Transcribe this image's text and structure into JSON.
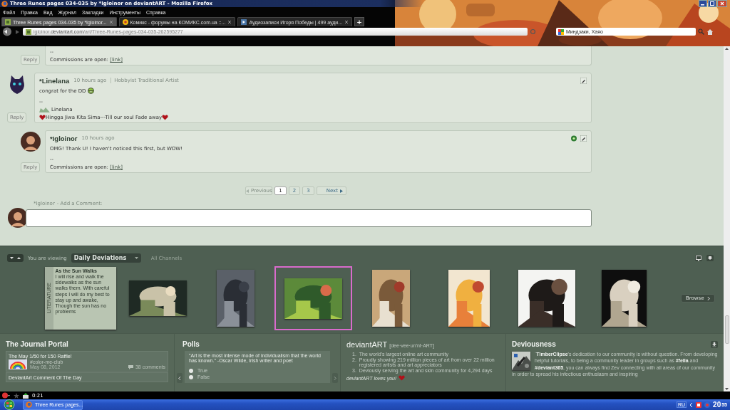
{
  "window": {
    "title": "Three Runes pages 034-035 by *Igloinor on deviantART - Mozilla Firefox"
  },
  "menu": [
    "Файл",
    "Правка",
    "Вид",
    "Журнал",
    "Закладки",
    "Инструменты",
    "Справка"
  ],
  "tabs": [
    {
      "label": "Three Runes pages 034-035 by *Igloinor...",
      "selected": true
    },
    {
      "label": "Комикс - форумы на КОМИКС.com.ua ::...",
      "selected": false
    },
    {
      "label": "Аудиозаписи Игоря Победы | 499 ауди...",
      "selected": false
    }
  ],
  "new_tab": "+",
  "address": {
    "subdomain": "igloinor.",
    "domain": "deviantart.com",
    "path": "/art/Three-Runes-pages-034-035-262595277"
  },
  "search": {
    "value": "Миндзаки, Хаяо"
  },
  "comments": [
    {
      "children": [
        {
          "separator": "--",
          "signature": "Commissions are open:",
          "link": "[link]",
          "reply": "Reply",
          "editable": false,
          "emoticon": false,
          "badge": false
        }
      ]
    },
    {
      "author": "*Linelana",
      "time": "10 hours ago",
      "role": "Hobbyist Traditional Artist",
      "body": "congrat for the DD",
      "emoticon": true,
      "separator": "--",
      "sig_name": "Linelana",
      "sig_line": "Hingga Jiwa Kita Sima---Till our soul Fade away",
      "reply": "Reply",
      "editable": true,
      "badge": false,
      "children": [
        {
          "author": "*Igloinor",
          "time": "10 hours ago",
          "body": "OMG! Thank U! I haven't noticed this first, but WOW!",
          "emoticon": false,
          "separator": "--",
          "signature": "Commissions are open:",
          "link": "[link]",
          "reply": "Reply",
          "editable": true,
          "badge": true
        }
      ]
    }
  ],
  "pagination": {
    "previous": {
      "label": "Previous",
      "disabled": true
    },
    "pages": [
      {
        "label": "1",
        "selected": true
      },
      {
        "label": "2",
        "selected": false
      },
      {
        "label": "3",
        "selected": false
      }
    ],
    "next": {
      "label": "Next",
      "disabled": false
    }
  },
  "add_comment": {
    "user": "*Igloinor",
    "label": "- Add a Comment:"
  },
  "strip": {
    "viewing_label": "You are viewing",
    "channel": "Daily Deviations",
    "all_channels": "All Channels",
    "browse": "Browse",
    "thumbnails": [
      {
        "kind": "literature",
        "tag": "LITERATURE",
        "title": "As the Sun Walks",
        "text": "I will rise and walk the sidewalks as the sun walks them. With careful steps I will do my best to stay up and awake, Though the sun has no problems",
        "selected": false
      },
      {
        "kind": "picture",
        "selected": false
      },
      {
        "kind": "picture",
        "selected": false
      },
      {
        "kind": "picture",
        "selected": true
      },
      {
        "kind": "picture",
        "selected": false
      },
      {
        "kind": "picture",
        "selected": false
      },
      {
        "kind": "picture",
        "selected": false
      },
      {
        "kind": "picture",
        "selected": false
      }
    ]
  },
  "journal": {
    "title": "The Journal Portal",
    "items": [
      {
        "title": "The May 1/50 for 150 Raffle!",
        "group": "#color-me-club",
        "date": "May 08, 2012",
        "comments": "38 comments"
      },
      {
        "title": "DeviantArt Comment Of The Day"
      }
    ]
  },
  "polls": {
    "title": "Polls",
    "question": "\"Art is the most intense mode of individualism that the world has known.\" -Oscar Wilde, Irish writer and poet",
    "options": [
      {
        "label": "True",
        "selected": false
      },
      {
        "label": "False",
        "selected": false
      }
    ]
  },
  "about": {
    "title": "deviantART",
    "pronunciation": "[dee·vee·un'nt·ART]",
    "facts": [
      {
        "number": "1.",
        "text": "The world's largest online art community"
      },
      {
        "number": "2.",
        "text": "Proudly showing 219 million pieces of art from over 22 million registered artists and art appreciators"
      },
      {
        "number": "3.",
        "text": "Deviously serving the art and skin community for 4,294 days"
      }
    ],
    "tagline": "deviantART loves you!"
  },
  "devious": {
    "title": "Deviousness",
    "text": "`**TimberClipse**'s dedication to our community is without question. From developing helpful tutorials, to being a community leader in groups such as **#fella** and **#deviant365**, you can always find Zev connecting with all areas of our community in order to spread his infectious enthusiasm and inspiring"
  },
  "status": {
    "time": "0:21"
  },
  "taskbar": {
    "task": "Three Runes pages...",
    "language": "RU",
    "clock_hours": "20",
    "clock_minutes": "55"
  }
}
